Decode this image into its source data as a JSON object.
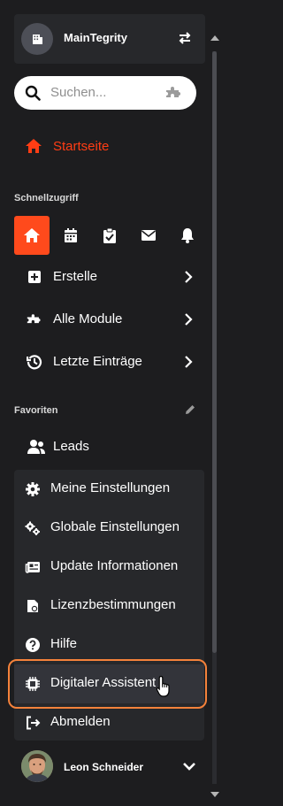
{
  "org": {
    "name": "MainTegrity"
  },
  "search": {
    "placeholder": "Suchen..."
  },
  "home": {
    "label": "Startseite"
  },
  "quick_access": {
    "title": "Schnellzugriff",
    "buttons": [
      "home-icon",
      "calendar-icon",
      "clipboard-check-icon",
      "mail-icon",
      "bell-icon"
    ]
  },
  "nav": {
    "items": [
      {
        "label": "Erstelle",
        "icon": "plus-square-icon"
      },
      {
        "label": "Alle Module",
        "icon": "puzzle-icon"
      },
      {
        "label": "Letzte Einträge",
        "icon": "history-icon"
      }
    ]
  },
  "favorites": {
    "title": "Favoriten",
    "items": [
      {
        "label": "Leads",
        "icon": "users-icon"
      }
    ]
  },
  "menu": {
    "items": [
      {
        "label": "Meine Einstellungen",
        "icon": "gear-icon"
      },
      {
        "label": "Globale Einstellungen",
        "icon": "gears-icon"
      },
      {
        "label": "Update Informationen",
        "icon": "newspaper-icon"
      },
      {
        "label": "Lizenzbestimmungen",
        "icon": "license-icon"
      },
      {
        "label": "Hilfe",
        "icon": "help-icon"
      },
      {
        "label": "Digitaler Assistent",
        "icon": "chip-icon"
      },
      {
        "label": "Abmelden",
        "icon": "logout-icon"
      }
    ]
  },
  "user": {
    "name": "Leon Schneider"
  },
  "colors": {
    "accent": "#ff4a1c",
    "highlight": "#f5823b",
    "panel": "#27282b",
    "background": "#1d1d1f"
  }
}
